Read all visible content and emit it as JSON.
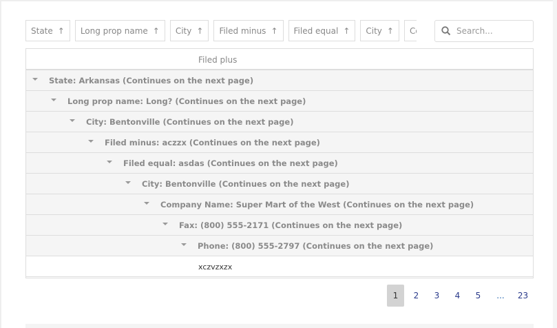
{
  "group_panel": {
    "chips": [
      {
        "label": "State",
        "icon": "arrow-up-icon"
      },
      {
        "label": "Long prop name",
        "icon": "arrow-up-icon"
      },
      {
        "label": "City",
        "icon": "arrow-up-icon"
      },
      {
        "label": "Filed minus",
        "icon": "arrow-up-icon"
      },
      {
        "label": "Filed equal",
        "icon": "arrow-up-icon"
      },
      {
        "label": "City",
        "icon": "arrow-up-icon"
      },
      {
        "label": "Com"
      }
    ]
  },
  "search": {
    "placeholder": "Search..."
  },
  "grid": {
    "column_header": "Filed plus",
    "group_rows": [
      "State: Arkansas (Continues on the next page)",
      "Long prop name: Long? (Continues on the next page)",
      "City: Bentonville (Continues on the next page)",
      "Filed minus: aczzx (Continues on the next page)",
      "Filed equal: asdas (Continues on the next page)",
      "City: Bentonville (Continues on the next page)",
      "Company Name: Super Mart of the West (Continues on the next page)",
      "Fax: (800) 555-2171 (Continues on the next page)",
      "Phone: (800) 555-2797 (Continues on the next page)"
    ],
    "data_rows": [
      {
        "filed_plus": "xczvzxzx"
      }
    ]
  },
  "pager": {
    "pages": [
      "1",
      "2",
      "3",
      "4",
      "5",
      "...",
      "23"
    ],
    "current": "1"
  }
}
